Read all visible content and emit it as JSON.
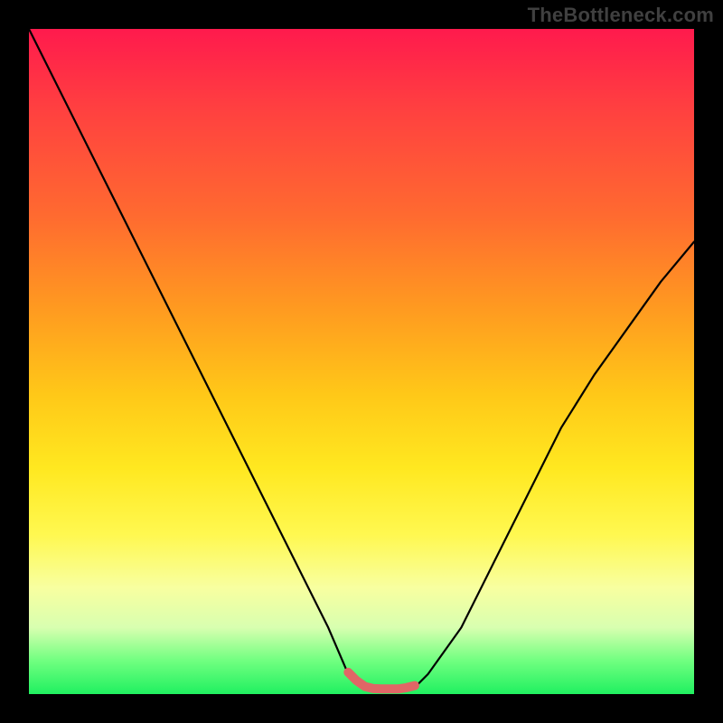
{
  "watermark": "TheBottleneck.com",
  "chart_data": {
    "type": "line",
    "title": "",
    "xlabel": "",
    "ylabel": "",
    "xlim": [
      0,
      100
    ],
    "ylim": [
      0,
      100
    ],
    "series": [
      {
        "name": "bottleneck-curve",
        "x": [
          0,
          5,
          10,
          15,
          20,
          25,
          30,
          35,
          40,
          45,
          48,
          50,
          52,
          54,
          56,
          58,
          60,
          65,
          70,
          75,
          80,
          85,
          90,
          95,
          100
        ],
        "values": [
          100,
          90,
          80,
          70,
          60,
          50,
          40,
          30,
          20,
          10,
          3,
          1,
          0.5,
          0.5,
          0.5,
          1,
          3,
          10,
          20,
          30,
          40,
          48,
          55,
          62,
          68
        ]
      }
    ],
    "annotations": [
      {
        "name": "optimal-band",
        "x_start": 48,
        "x_end": 58,
        "y": 0.7
      }
    ]
  }
}
